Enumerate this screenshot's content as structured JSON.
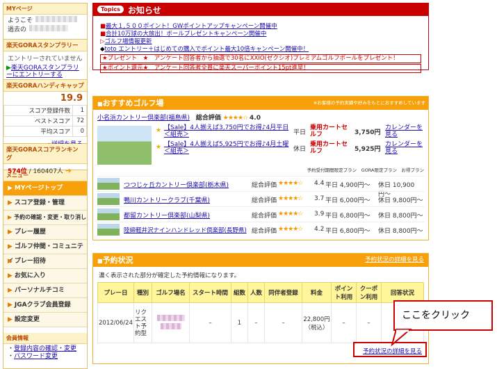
{
  "sidebar": {
    "mypage_label": "MYページ",
    "welcome": "ようこそ",
    "last_visit": "過去の",
    "stamp_rally_title": "楽天GORAスタンプラリー",
    "stamp_rally_status": "エントリーされていません",
    "stamp_rally_link": "楽天GORAスタンプラリーにエントリーする",
    "handicap_title": "楽天GORAハンディキャップ",
    "handicap_value": "19.9",
    "stats": [
      {
        "label": "スコア登録件数",
        "value": "1"
      },
      {
        "label": "ベストスコア",
        "value": "72"
      },
      {
        "label": "平均スコア",
        "value": "0"
      }
    ],
    "detail_link": "詳細を見る",
    "ranking_title": "楽天GORAスコアランキング",
    "ranking_rank": "574位",
    "ranking_total": "/ 160407人",
    "menu_label": "メニュー",
    "menu_items": [
      "MYページトップ",
      "スコア登録・管理",
      "予約の確認・変更・取り消し",
      "プレー履歴",
      "ゴルフ仲間・コミュニティ",
      "プレー招待",
      "お気に入り",
      "パーソナルチコミ",
      "JGAクラブ会員登録",
      "設定変更"
    ],
    "member_label": "会員情報",
    "member_links": [
      "登録内容の確認・変更",
      "パスワード変更"
    ]
  },
  "topics": {
    "tag": "Topics",
    "title": "お知らせ",
    "items": [
      "最大１,５００ポイント！GWポイントアップキャンペーン開催中",
      "合計10万球の大放出！ボールプレゼントキャンペーン開催中",
      "ゴルフ場情報更新",
      "toto エントリー＋はじめての購入でポイント最大10倍キャンペーン開催中！"
    ],
    "promo1": "★プレゼント　★　アンケート回答者から抽選で30名にXXIO(ゼクシオ)プレミアムゴルフボールをプレゼント！",
    "promo2": "★ポイント還元★　アンケート回答者全員に楽天スーパーポイント15pt進呈！"
  },
  "recommend": {
    "title": "おすすめゴルフ場",
    "note": "※お客様の予約実績や好みをもとにおすすめしています",
    "main_course": "小名浜カントリー倶楽部(福島県)",
    "eval_label": "総合評価",
    "main_stars": "★★★★☆",
    "main_score": "4.0",
    "plans": [
      {
        "name": "【Sale】4人揃えば3,750円でお得♪4月平日＜組売＞",
        "day": "平日",
        "cart": "乗用カートセルフ",
        "price": "3,750円",
        "cal": "カレンダーを見る"
      },
      {
        "name": "【Sale】4人揃えば5,925円でお得♪4月土曜＜組売＞",
        "day": "休日",
        "cart": "乗用カートセルフ",
        "price": "5,925円",
        "cal": "カレンダーを見る"
      }
    ],
    "plan_legend": "予約受付期間限定プラン　GORA限定プラン　お得プラン",
    "courses": [
      {
        "name": "つつじヶ丘カントリー倶楽部(栃木県)",
        "stars": "★★★★☆",
        "score": "4.4",
        "weekday": "平日 4,900円〜",
        "holiday": "休日 10,900円〜"
      },
      {
        "name": "鴨川カントリークラブ(千葉県)",
        "stars": "★★★★☆",
        "score": "3.7",
        "weekday": "平日 6,000円〜",
        "holiday": "休日 9,800円〜"
      },
      {
        "name": "都留カントリー倶楽部(山梨県)",
        "stars": "★★★★☆",
        "score": "3.9",
        "weekday": "平日 6,800円〜",
        "holiday": "休日 8,800円〜"
      },
      {
        "name": "陸締軽井沢ナインハンドレッド倶楽部(長野県)",
        "stars": "★★★★☆",
        "score": "4.2",
        "weekday": "平日 6,800円〜",
        "holiday": "休日 8,800円〜"
      }
    ]
  },
  "reservation": {
    "title": "予約状況",
    "detail_link": "予約状況の詳細を見る",
    "note": "濃く表示された部分が確定した予約情報になります。",
    "headers": [
      "プレー日",
      "種別",
      "ゴルフ場名",
      "スタート時間",
      "組数",
      "人数",
      "同伴者登録",
      "料金",
      "ポイント利用",
      "クーポン利用",
      "回答状況"
    ],
    "row": {
      "date": "2012/06/24",
      "type": "リクエスト予約型",
      "start": "–",
      "groups": "1",
      "people": "–",
      "companion": "–",
      "fee": "22,800円（税込）",
      "point": "–",
      "coupon": "–",
      "answer": ""
    },
    "bottom_link": "予約状況の詳細を見る",
    "callout": "ここをクリック"
  }
}
